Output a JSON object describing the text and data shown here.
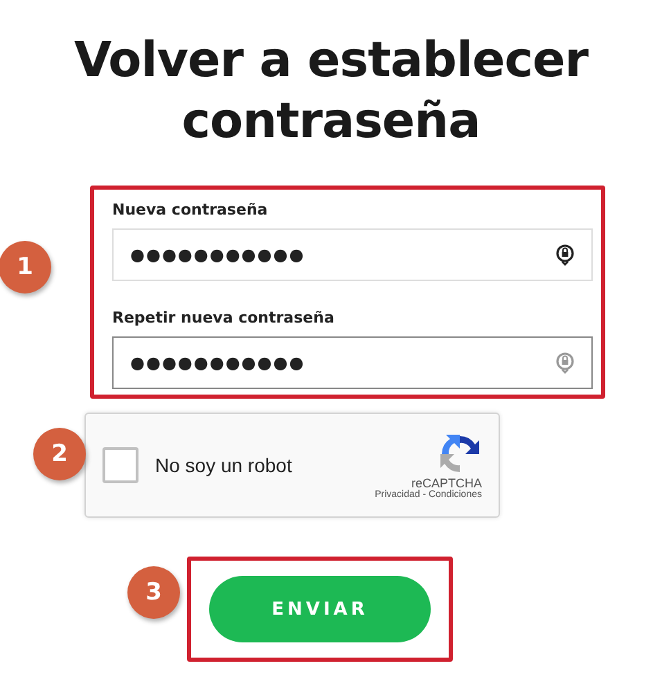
{
  "title": "Volver a establecer contraseña",
  "fields": [
    {
      "label": "Nueva contraseña",
      "value": "●●●●●●●●●●●",
      "focused": false
    },
    {
      "label": "Repetir nueva contraseña",
      "value": "●●●●●●●●●●●",
      "focused": true
    }
  ],
  "captcha": {
    "label": "No soy un robot",
    "checked": false,
    "brand": "reCAPTCHA",
    "links": "Privacidad - Condiciones"
  },
  "submit": {
    "label": "ENVIAR"
  },
  "annotations": [
    {
      "label": "1"
    },
    {
      "label": "2"
    },
    {
      "label": "3"
    }
  ]
}
